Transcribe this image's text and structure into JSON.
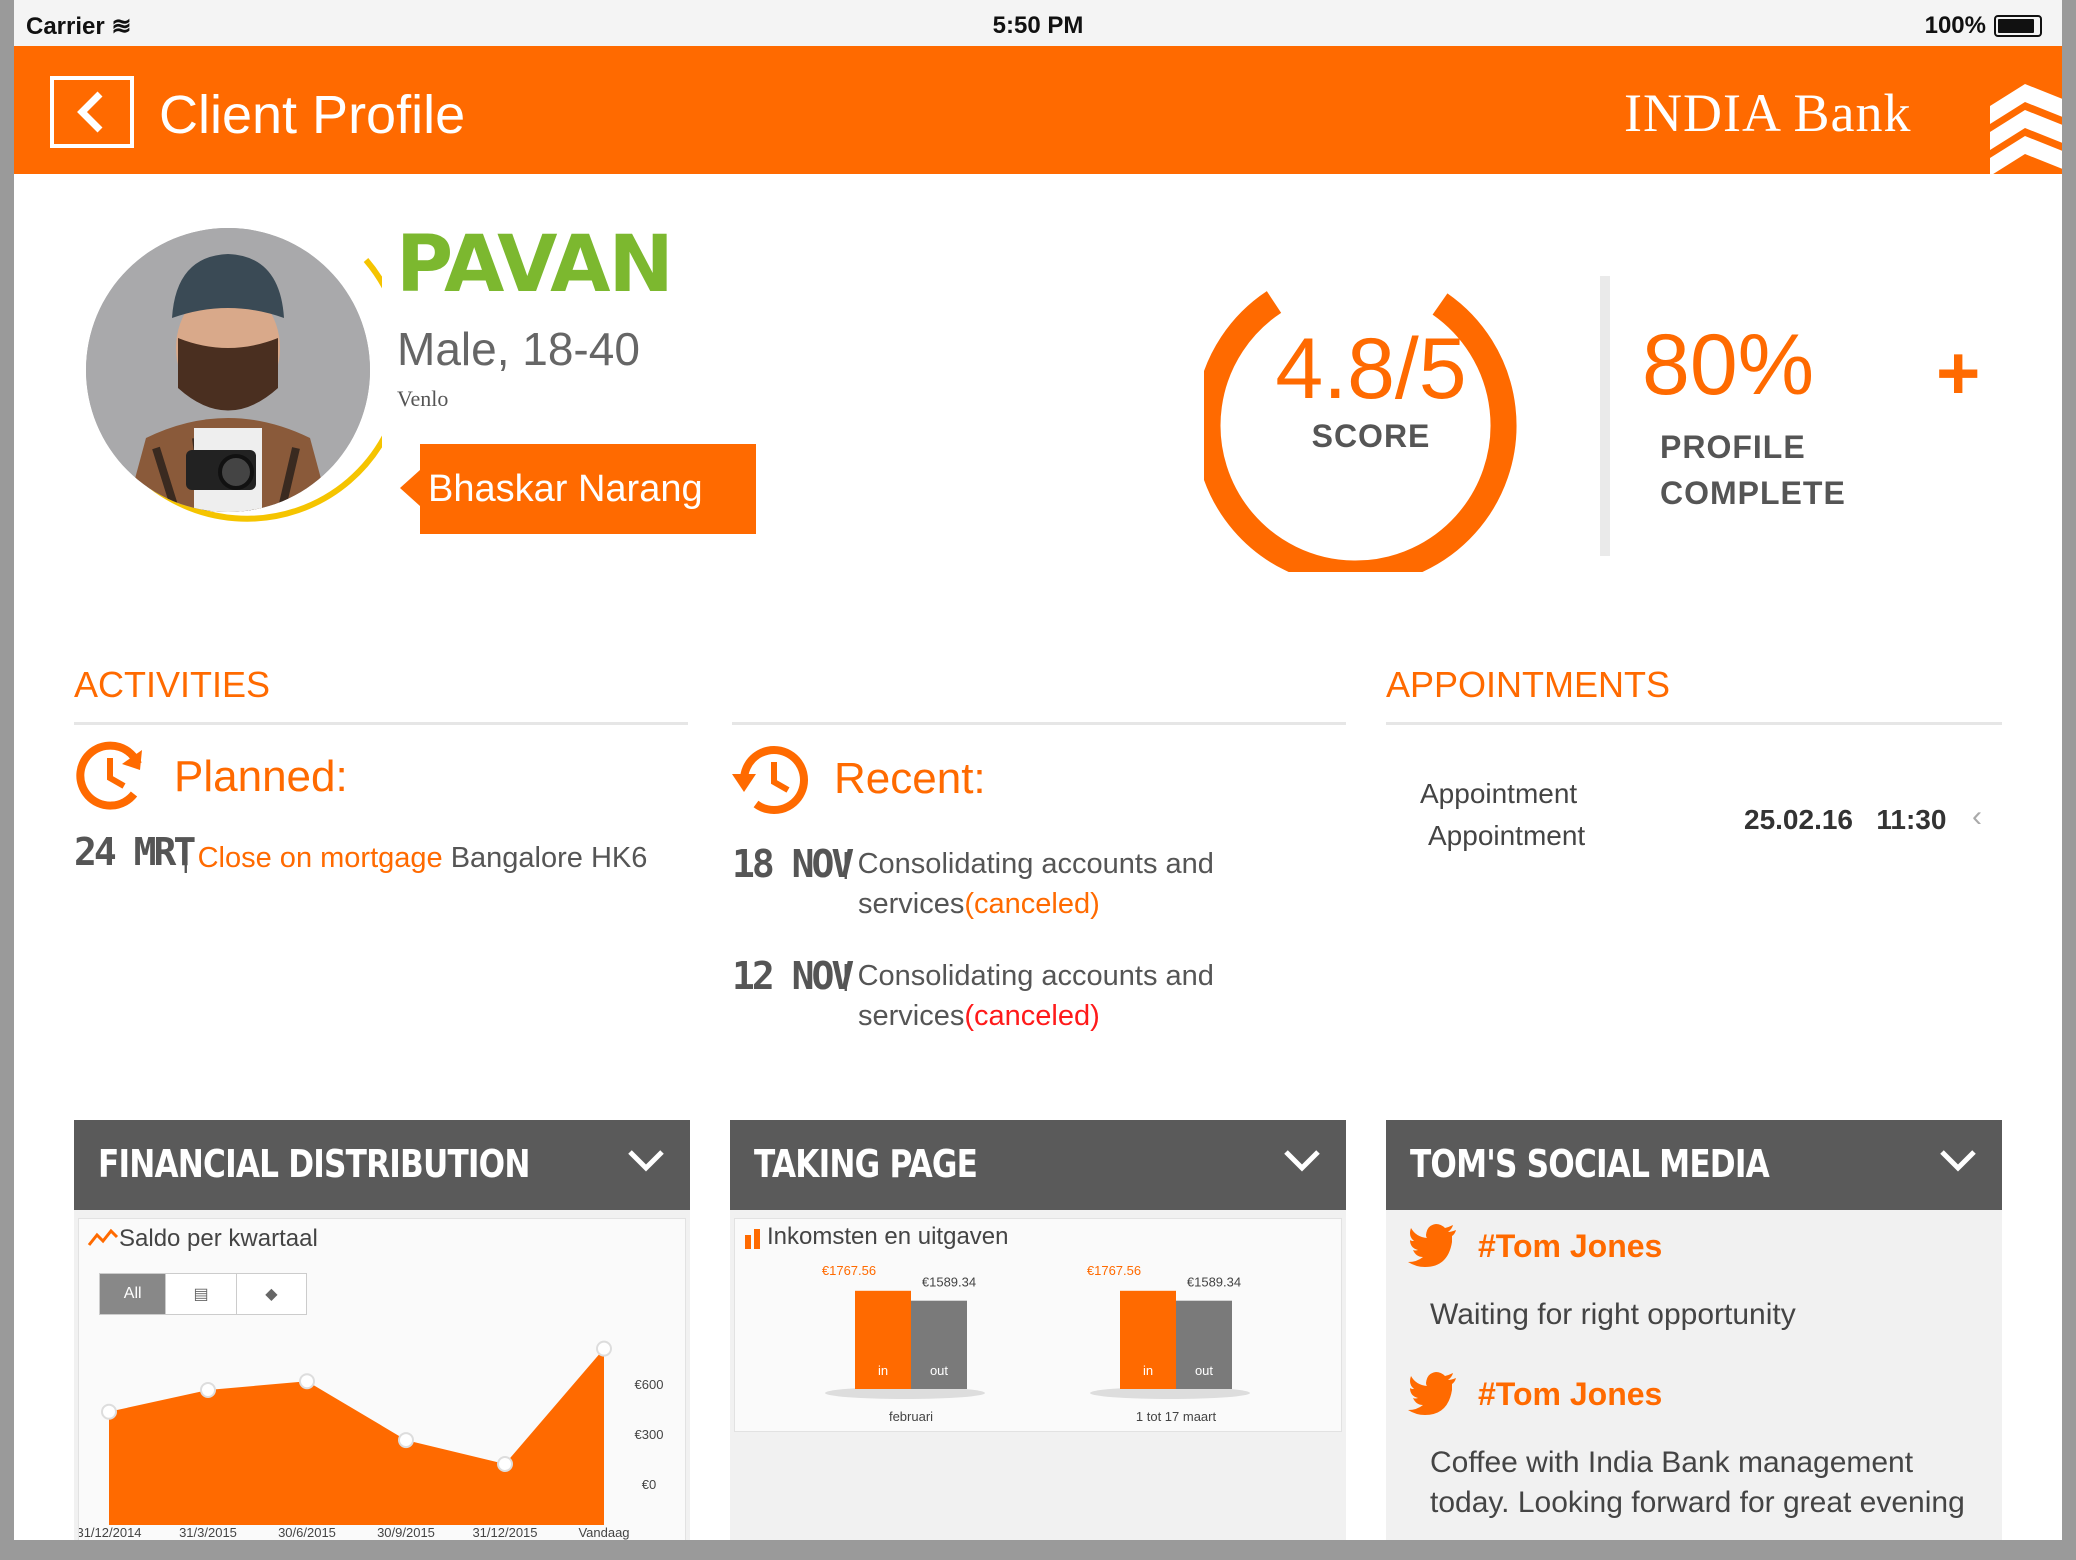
{
  "status": {
    "carrier": "Carrier",
    "time": "5:50 PM",
    "battery": "100%"
  },
  "nav": {
    "title": "Client Profile",
    "brand": "INDIA Bank"
  },
  "profile": {
    "name": "PAVAN",
    "gender_age": "Male, 18-40",
    "city": "Venlo",
    "advisor": "Bhaskar Narang"
  },
  "score": {
    "value": "4.8/5",
    "label": "SCORE",
    "fill": 0.96
  },
  "profile_complete": {
    "value": "80%",
    "line1": "PROFILE",
    "line2": "COMPLETE",
    "add": "+"
  },
  "activities": {
    "title": "ACTIVITIES",
    "planned": {
      "label": "Planned:",
      "date": "24 MRT",
      "sep": "|",
      "link": "Close on mortgage",
      "place": " Bangalore HK6"
    },
    "recent": {
      "label": "Recent:",
      "items": [
        {
          "date": "18 NOV",
          "sep": "|",
          "line1": "Consolidating accounts and",
          "line2": "services",
          "status": "(canceled)"
        },
        {
          "date": "12 NOV",
          "sep": "|",
          "line1": "Consolidating accounts and",
          "line2": "services",
          "status": "(canceled)"
        }
      ]
    }
  },
  "appointments": {
    "title": "APPOINTMENTS",
    "items": [
      {
        "line1": "Appointment",
        "line2": "Appointment",
        "date": "25.02.16",
        "time": "11:30"
      }
    ]
  },
  "cards": {
    "financial": {
      "title": "FINANCIAL DISTRIBUTION",
      "chart_title": "Saldo per kwartaal",
      "filter_all": "All"
    },
    "taking": {
      "title": "TAKING PAGE",
      "chart_title": "Inkomsten en uitgaven"
    },
    "social": {
      "title": "TOM'S SOCIAL MEDIA",
      "posts": [
        {
          "handle": "#Tom Jones",
          "text": "Waiting for right opportunity"
        },
        {
          "handle": "#Tom Jones",
          "text": "Coffee with India Bank management",
          "text2": "today. Looking forward for great evening"
        }
      ]
    }
  },
  "colors": {
    "accent": "#ff6a00",
    "name_green": "#7cb82f",
    "card_header": "#5a5a5a",
    "ring_yellow": "#f5c400"
  },
  "icons": {
    "back": "chevron-left-icon",
    "logo": "chevron-stack-icon",
    "planned": "clock-refresh-icon",
    "recent": "history-icon",
    "twitter": "twitter-icon",
    "chart": "line-chart-icon",
    "bar": "bar-chart-icon"
  },
  "chart_data": [
    {
      "type": "area",
      "title": "Saldo per kwartaal",
      "categories": [
        "31/12/2014",
        "31/3/2015",
        "30/6/2015",
        "30/9/2015",
        "31/12/2015",
        "Vandaag"
      ],
      "values": [
        520,
        620,
        660,
        390,
        280,
        810
      ],
      "yticks": [
        "€600",
        "€300",
        "€0"
      ],
      "ylim": [
        0,
        900
      ]
    },
    {
      "type": "bar",
      "title": "Inkomsten en uitgaven",
      "categories": [
        "februari",
        "1 tot 17 maart"
      ],
      "series": [
        {
          "name": "in",
          "values": [
            1767.56,
            1767.56
          ],
          "labels": [
            "€1767.56",
            "€1767.56"
          ]
        },
        {
          "name": "out",
          "values": [
            1589.34,
            1589.34
          ],
          "labels": [
            "€1589.34",
            "€1589.34"
          ]
        }
      ]
    }
  ]
}
